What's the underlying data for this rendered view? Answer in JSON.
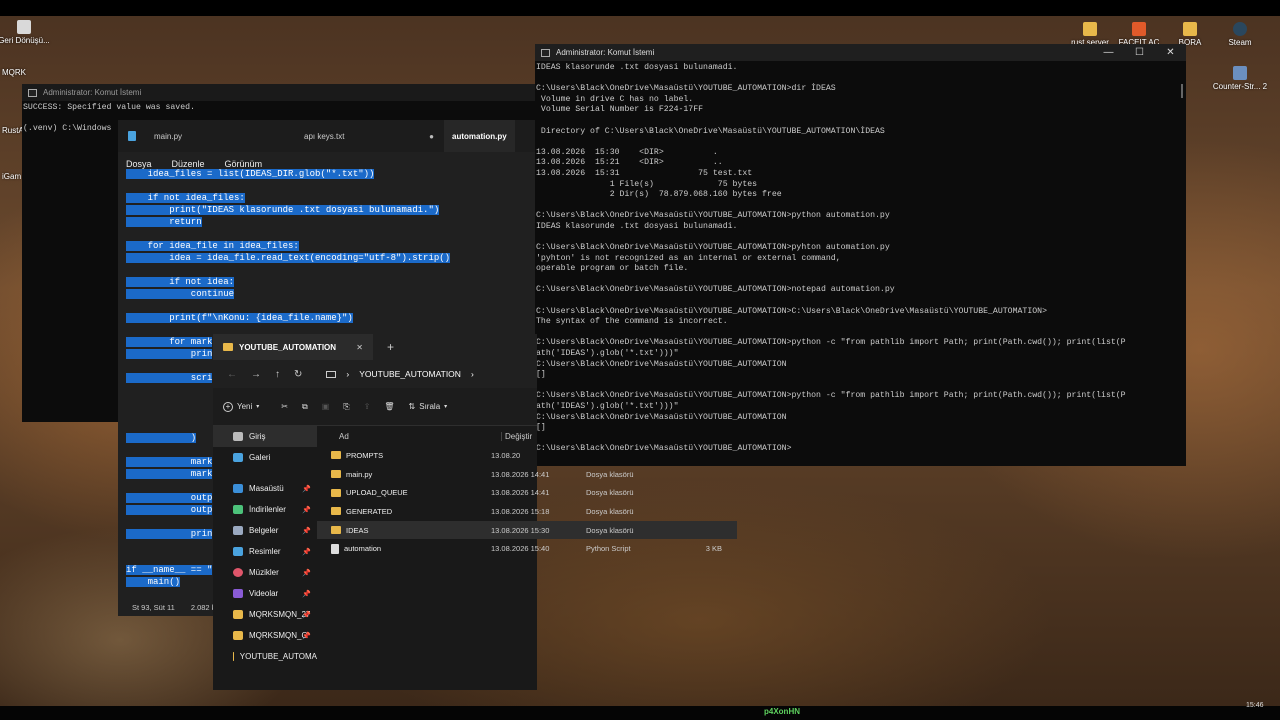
{
  "desktop_icons": [
    {
      "label": "Geri Dönüşü..."
    },
    {
      "label": "rust server"
    },
    {
      "label": "FACEIT AC"
    },
    {
      "label": "BORA"
    },
    {
      "label": "Steam"
    },
    {
      "label": "MQRK"
    },
    {
      "label": "Counter-Str... 2"
    },
    {
      "label": "RustA"
    },
    {
      "label": "iGam"
    }
  ],
  "bg_cmd": {
    "title": "Administrator: Komut İstemi",
    "lines": "SUCCESS: Specified value was saved.\n\n(.venv) C:\\Windows"
  },
  "main_cmd": {
    "title": "Administrator: Komut İstemi",
    "controls": {
      "minimize": "—",
      "maximize": "☐",
      "close": "✕"
    },
    "output": "IDEAS klasorunde .txt dosyasi bulunamadi.\n\nC:\\Users\\Black\\OneDrive\\Masaüstü\\YOUTUBE_AUTOMATION>dir İDEAS\n Volume in drive C has no label.\n Volume Serial Number is F224-17FF\n\n Directory of C:\\Users\\Black\\OneDrive\\Masaüstü\\YOUTUBE_AUTOMATION\\İDEAS\n\n13.08.2026  15:30    <DIR>          .\n13.08.2026  15:21    <DIR>          ..\n13.08.2026  15:31                75 test.txt\n               1 File(s)             75 bytes\n               2 Dir(s)  78.879.068.160 bytes free\n\nC:\\Users\\Black\\OneDrive\\Masaüstü\\YOUTUBE_AUTOMATION>python automation.py\nIDEAS klasorunde .txt dosyasi bulunamadi.\n\nC:\\Users\\Black\\OneDrive\\Masaüstü\\YOUTUBE_AUTOMATION>pyhton automation.py\n'pyhton' is not recognized as an internal or external command,\noperable program or batch file.\n\nC:\\Users\\Black\\OneDrive\\Masaüstü\\YOUTUBE_AUTOMATION>notepad automation.py\n\nC:\\Users\\Black\\OneDrive\\Masaüstü\\YOUTUBE_AUTOMATION>C:\\Users\\Black\\OneDrive\\Masaüstü\\YOUTUBE_AUTOMATION>\nThe syntax of the command is incorrect.\n\nC:\\Users\\Black\\OneDrive\\Masaüstü\\YOUTUBE_AUTOMATION>python -c \"from pathlib import Path; print(Path.cwd()); print(list(P\nath('IDEAS').glob('*.txt')))\"\nC:\\Users\\Black\\OneDrive\\Masaüstü\\YOUTUBE_AUTOMATION\n[]\n\nC:\\Users\\Black\\OneDrive\\Masaüstü\\YOUTUBE_AUTOMATION>python -c \"from pathlib import Path; print(Path.cwd()); print(list(P\nath('IDEAS').glob('*.txt')))\"\nC:\\Users\\Black\\OneDrive\\Masaüstü\\YOUTUBE_AUTOMATION\n[]\n\nC:\\Users\\Black\\OneDrive\\Masaüstü\\YOUTUBE_AUTOMATION>"
  },
  "editor": {
    "tabs": [
      {
        "label": "main.py"
      },
      {
        "label": "apı keys.txt",
        "modified": "●"
      },
      {
        "label": "automation.py"
      }
    ],
    "menu": [
      "Dosya",
      "Düzenle",
      "Görünüm"
    ],
    "code_lines": [
      "    idea_files = list(IDEAS_DIR.glob(\"*.txt\"))",
      "",
      "    if not idea_files:",
      "        print(\"IDEAS klasorunde .txt dosyasi bulunamadi.\")",
      "        return",
      "",
      "    for idea_file in idea_files:",
      "        idea = idea_file.read_text(encoding=\"utf-8\").strip()",
      "",
      "        if not idea:",
      "            continue",
      "",
      "        print(f\"\\nKonu: {idea_file.name}\")",
      "",
      "        for mark",
      "            prin",
      "",
      "            scri",
      "",
      "",
      "",
      "",
      "            )",
      "",
      "            mark",
      "            mark",
      "",
      "            outp",
      "            outp",
      "",
      "            prin",
      "",
      "",
      "if __name__ == \"",
      "    main()"
    ],
    "status": {
      "position": "St 93, Süt 11",
      "size": "2.082 k"
    }
  },
  "explorer": {
    "tab_title": "YOUTUBE_AUTOMATION",
    "tab_close": "✕",
    "new_tab": "+",
    "address": "YOUTUBE_AUTOMATION",
    "toolbar": {
      "new": "Yeni",
      "sort": "Sırala"
    },
    "sidebar": [
      {
        "label": "Giriş"
      },
      {
        "label": "Galeri"
      },
      {
        "label": "Masaüstü"
      },
      {
        "label": "İndirilenler"
      },
      {
        "label": "Belgeler"
      },
      {
        "label": "Resimler"
      },
      {
        "label": "Müzikler"
      },
      {
        "label": "Videolar"
      },
      {
        "label": "MQRKSMQN_27"
      },
      {
        "label": "MQRKSMQN_O"
      },
      {
        "label": "YOUTUBE_AUTOMA"
      }
    ],
    "columns": {
      "name": "Ad",
      "date": "Değiştir"
    },
    "files": [
      {
        "name": "PROMPTS",
        "date": "13.08.20",
        "type": "",
        "size": ""
      },
      {
        "name": "main.py",
        "date": "13.08.2026 14:41",
        "type": "Dosya klasörü",
        "size": ""
      },
      {
        "name": "UPLOAD_QUEUE",
        "date": "13.08.2026 14:41",
        "type": "Dosya klasörü",
        "size": ""
      },
      {
        "name": "GENERATED",
        "date": "13.08.2026 15:18",
        "type": "Dosya klasörü",
        "size": ""
      },
      {
        "name": "IDEAS",
        "date": "13.08.2026 15:30",
        "type": "Dosya klasörü",
        "size": ""
      },
      {
        "name": "automation",
        "date": "13.08.2026 15:40",
        "type": "Python Script",
        "size": "3 KB"
      }
    ]
  },
  "watermark": "p4XonHN",
  "clock": "15:46"
}
